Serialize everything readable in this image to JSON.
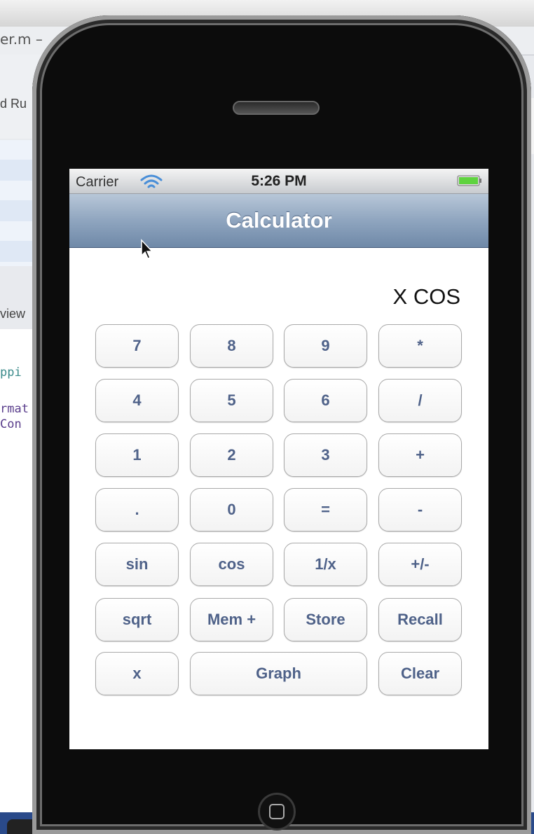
{
  "background": {
    "tab_title": "er.m –",
    "toolbar_label": "d Ru",
    "view_label": "view",
    "code_lines": [
      "ppi",
      "rmat",
      "Con"
    ]
  },
  "status_bar": {
    "carrier": "Carrier",
    "time": "5:26 PM",
    "wifi_icon": "wifi-icon",
    "battery_icon": "battery-full-icon",
    "battery_color": "#5fd33f"
  },
  "nav_bar": {
    "title": "Calculator"
  },
  "display": {
    "text": "X COS"
  },
  "keys": {
    "k7": "7",
    "k8": "8",
    "k9": "9",
    "mul": "*",
    "k4": "4",
    "k5": "5",
    "k6": "6",
    "div": "/",
    "k1": "1",
    "k2": "2",
    "k3": "3",
    "add": "+",
    "dot": ".",
    "k0": "0",
    "eq": "=",
    "sub": "-",
    "sin": "sin",
    "cos": "cos",
    "inv": "1/x",
    "neg": "+/-",
    "sqrt": "sqrt",
    "memplus": "Mem +",
    "store": "Store",
    "recall": "Recall",
    "x": "x",
    "graph": "Graph",
    "clear": "Clear"
  },
  "colors": {
    "key_text": "#4f6289",
    "nav_bar": "#8fa5bf"
  }
}
